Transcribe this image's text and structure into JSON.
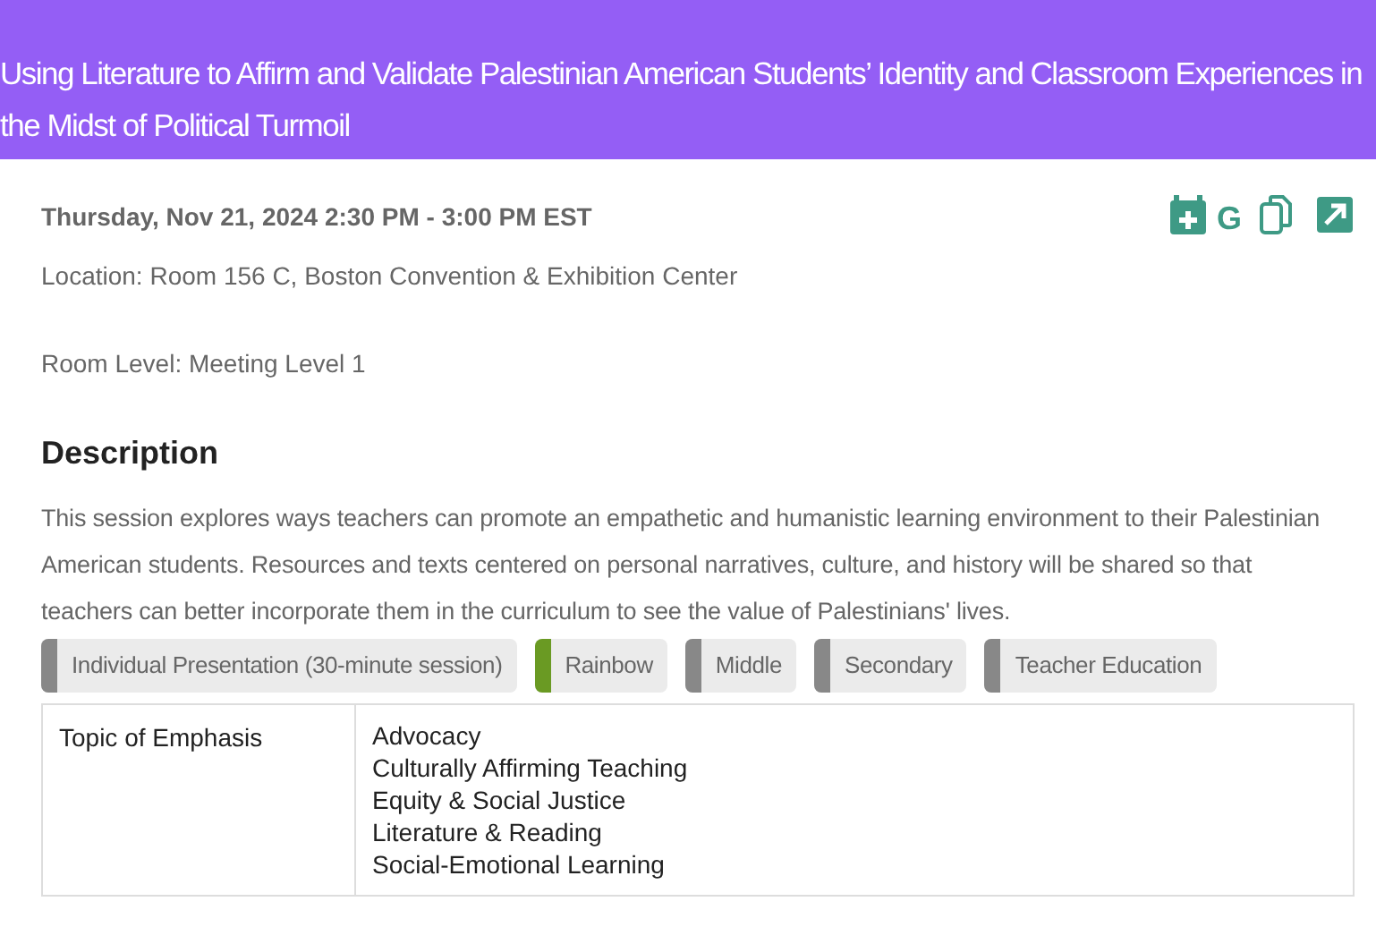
{
  "title": "Using Literature to Affirm and Validate Palestinian American Students’ Identity and Classroom Experiences in the Midst of Political Turmoil",
  "datetime": "Thursday, Nov 21, 2024 2:30 PM - 3:00 PM EST",
  "google_label": "G",
  "location": "Location: Room 156 C, Boston Convention & Exhibition Center",
  "room_level": "Room Level: Meeting Level 1",
  "description_heading": "Description",
  "description": "This session explores ways teachers can promote an empathetic and humanistic learning environment to their Palestinian American students. Resources and texts centered on personal narratives, culture, and history will be shared so that teachers can better incorporate them in the curriculum to see the value of Palestinians' lives.",
  "tags": [
    {
      "label": "Individual Presentation (30-minute session)",
      "color": "#888888"
    },
    {
      "label": "Rainbow",
      "color": "#6a9a23"
    },
    {
      "label": "Middle",
      "color": "#888888"
    },
    {
      "label": "Secondary",
      "color": "#888888"
    },
    {
      "label": "Teacher Education",
      "color": "#888888"
    }
  ],
  "table": {
    "rows": [
      {
        "label": "Topic of Emphasis",
        "values": [
          "Advocacy",
          "Culturally Affirming Teaching",
          "Equity & Social Justice",
          "Literature & Reading",
          "Social-Emotional Learning"
        ]
      }
    ]
  }
}
